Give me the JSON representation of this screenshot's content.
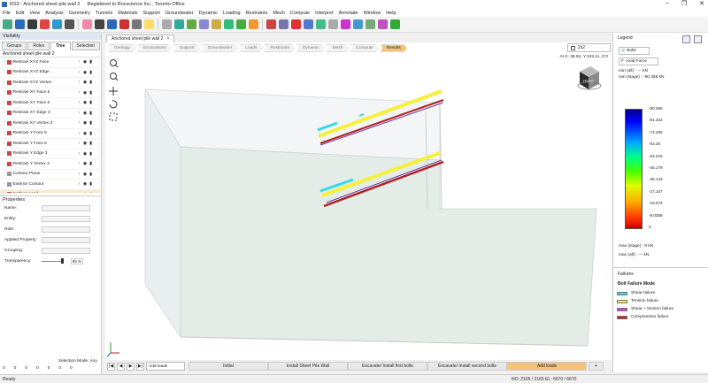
{
  "window": {
    "app_icon": "rs3-logo",
    "title": "RS3 - Anchored sheet pile wall 2",
    "registration": "Registered to Rocscience Inc., Toronto Office"
  },
  "menu": [
    "File",
    "Edit",
    "View",
    "Analysis",
    "Geometry",
    "Tunnels",
    "Materials",
    "Support",
    "Groundwater",
    "Dynamic",
    "Loading",
    "Restraints",
    "Mesh",
    "Compute",
    "Interpret",
    "Annotate",
    "Window",
    "Help"
  ],
  "left_panel": {
    "title": "Visibility",
    "tabs": [
      "Groups",
      "Roles",
      "Tree",
      "Selection"
    ],
    "active_tab": "Tree",
    "tree_root": "Anchored sheet pile wall 2",
    "tree_items": [
      {
        "label": "Restrain XYZ Face",
        "color": "#c44"
      },
      {
        "label": "Restrain XYZ Edge",
        "color": "#c44"
      },
      {
        "label": "Restrain XYZ Vertex",
        "color": "#c44"
      },
      {
        "label": "Restrain XY Face 5",
        "color": "#c44"
      },
      {
        "label": "Restrain XY Face 6",
        "color": "#c44"
      },
      {
        "label": "Restrain XY Edge 3",
        "color": "#c44"
      },
      {
        "label": "Restrain XY Vertex 3",
        "color": "#c44"
      },
      {
        "label": "Restrain Y Face 5",
        "color": "#c44"
      },
      {
        "label": "Restrain Y Face 6",
        "color": "#c44"
      },
      {
        "label": "Restrain Y Edge 3",
        "color": "#c44"
      },
      {
        "label": "Restrain Y Vertex 3",
        "color": "#c44"
      },
      {
        "label": "Contour Plane",
        "color": "#999"
      },
      {
        "label": "Exterior Contour",
        "color": "#999"
      },
      {
        "label": "Surface Load",
        "color": "#c44"
      }
    ],
    "properties_title": "Properties",
    "properties": [
      "Name:",
      "Entity:",
      "Role:",
      "Applied Property:",
      "Grouping:"
    ],
    "transparency_label": "Transparency:",
    "transparency_value": "85 %",
    "selection_mode": "Selection Mode: Any",
    "counts": [
      "0",
      "0",
      "0",
      "0",
      "0",
      "0",
      "0"
    ]
  },
  "view_tab": {
    "label": "Anchored sheet pile wall 2"
  },
  "stages": [
    "Geology",
    "Excavations",
    "Support",
    "Groundwater",
    "Loads",
    "Restraints",
    "Dynamic",
    "Mesh",
    "Compute",
    "Results"
  ],
  "active_stage": "Results",
  "layout_label": "2x2",
  "viewport": {
    "coords": "At X: 38.92, Y:103.11, Z:0",
    "cube_label": "FRONT"
  },
  "bottom": {
    "load_selector": "Add loads",
    "stage_tabs": [
      "Initial",
      "Install Sheet Pile Wall",
      "Excavate/ Install first bolts",
      "Excavate/ Install second bolts",
      "Add loads"
    ],
    "active_stage_tab": "Add loads",
    "add_label": "+"
  },
  "legend": {
    "title": "Legend",
    "entity": "Bolts",
    "result": "Axial Force",
    "min_all": "min (all) :    ---  kN",
    "min_stage": "min (stage) : -90.358 kN",
    "scale_values": [
      "-90.358",
      "-81.322",
      "-72.286",
      "-63.25",
      "-54.215",
      "-45.179",
      "-36.143",
      "-27.107",
      "-18.072",
      "-9.0358",
      "0"
    ],
    "max_stage": "max (stage) : 0 kN",
    "max_all": "max (all) :    ---  kN",
    "failures_title": "Failures",
    "bolt_failure_title": "Bolt Failure Mode",
    "failure_modes": [
      {
        "label": "Shear failure",
        "color": "#35d8e6"
      },
      {
        "label": "Tension failure",
        "color": "#f5f03a"
      },
      {
        "label": "Shear + tension failure",
        "color": "#d040d0"
      },
      {
        "label": "Compression failure",
        "color": "#c02020"
      }
    ]
  },
  "status": {
    "ready": "Ready",
    "info": "NO: 2165 / 2165  EL: 6670 / 6670"
  }
}
